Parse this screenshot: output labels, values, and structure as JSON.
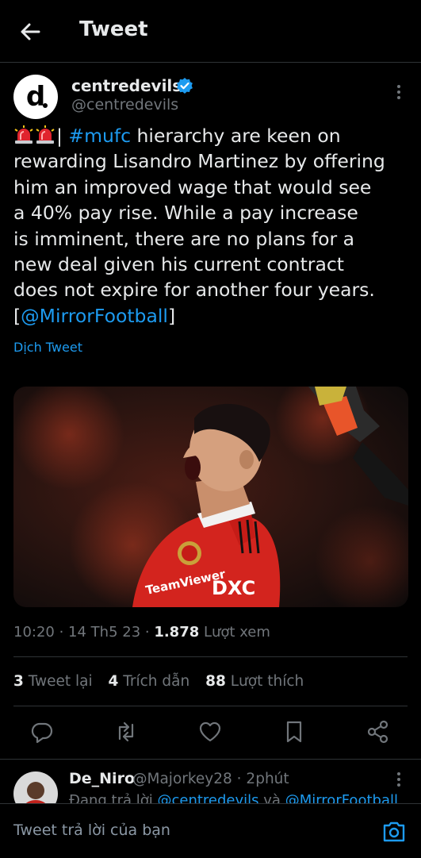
{
  "header": {
    "title": "Tweet"
  },
  "author": {
    "avatar_letter": "d",
    "name": "centredevils.",
    "handle": "@centredevils"
  },
  "tweet": {
    "lines": [
      {
        "pre": "",
        "link": "#mufc",
        "post": " hierarchy are keen on",
        "sirens": true,
        "bar": "| "
      },
      {
        "text": "rewarding Lisandro Martinez by offering"
      },
      {
        "text": "him an improved wage that would see"
      },
      {
        "text": "a 40% pay rise. While a pay increase"
      },
      {
        "text": "is imminent, there are no plans for a"
      },
      {
        "text": "new deal given his current contract"
      },
      {
        "text": "does not expire for another four years."
      }
    ],
    "mention_open": "[",
    "mention": "@MirrorFootball",
    "mention_close": "]",
    "translate": "Dịch Tweet"
  },
  "meta": {
    "time": "10:20 · 14 Th5 23 · ",
    "views": "1.878",
    "views_label": " Lượt xem"
  },
  "stats": {
    "retweets": "3",
    "retweets_label": " Tweet lại",
    "quotes": "4",
    "quotes_label": " Trích dẫn",
    "likes": "88",
    "likes_label": " Lượt thích"
  },
  "actions": [
    "reply-icon",
    "retweet-icon",
    "like-icon",
    "bookmark-icon",
    "share-icon"
  ],
  "reply": {
    "name": "De_Niro",
    "handle": "@Majorkey28 · 2phút",
    "sub_prefix": "Đang trả lời ",
    "sub_mention1": "@centredevils",
    "sub_and": " và ",
    "sub_mention2": "@MirrorFootball"
  },
  "composer": {
    "placeholder": "Tweet trả lời của bạn"
  },
  "colors": {
    "accent": "#1d9bf0",
    "background": "#000000",
    "text": "#e7e9ea",
    "muted": "#71767b"
  }
}
